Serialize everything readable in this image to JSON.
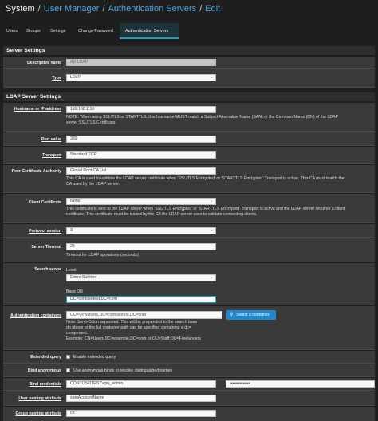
{
  "breadcrumb": {
    "system": "System",
    "sep": "/",
    "user_manager": "User Manager",
    "auth_servers": "Authentication Servers",
    "edit": "Edit"
  },
  "tabs": [
    {
      "label": "Users"
    },
    {
      "label": "Groups"
    },
    {
      "label": "Settings"
    },
    {
      "label": "Change Password"
    },
    {
      "label": "Authentication Servers"
    }
  ],
  "server_settings": {
    "heading": "Server Settings",
    "descriptive_name": {
      "label": "Descriptive name",
      "value": "AD LDAP"
    },
    "type": {
      "label": "Type",
      "value": "LDAP"
    }
  },
  "ldap": {
    "heading": "LDAP Server Settings",
    "hostname": {
      "label": "Hostname or IP address",
      "value": "192.168.2.10",
      "help": "NOTE: When using SSL/TLS or STARTTLS, this hostname MUST match a Subject Alternative Name (SAN) or the Common Name (CN) of the LDAP\nserver SSL/TLS Certificate."
    },
    "port": {
      "label": "Port value",
      "value": "389"
    },
    "transport": {
      "label": "Transport",
      "value": "Standard TCP"
    },
    "peer_ca": {
      "label": "Peer Certificate Authority",
      "value": "Global Root CA List",
      "help": "This CA is used to validate the LDAP server certificate when 'SSL/TLS Encrypted' or 'STARTTLS Encrypted' Transport is active. This CA must match the\nCA used by the LDAP server."
    },
    "client_cert": {
      "label": "Client Certificate",
      "value": "None",
      "help": "This certificate is sent to the LDAP server when 'SSL/TLS Encrypted' or 'STARTTLS Encrypted' Transport is active and the LDAP server requires a client\ncertificate. This certificate must be issued by the CA the LDAP server uses to validate connecting clients."
    },
    "protocol": {
      "label": "Protocol version",
      "value": "3"
    },
    "timeout": {
      "label": "Server Timeout",
      "value": "25",
      "help": "Timeout for LDAP operations (seconds)"
    },
    "scope": {
      "label": "Search scope",
      "level_label": "Level",
      "level_value": "Entire Subtree",
      "base_dn_label": "Base DN",
      "base_dn_value": "DC=contosotest,DC=com"
    },
    "containers": {
      "label": "Authentication containers",
      "value": "OU=VPNUsers,DC=contosotest,DC=com",
      "button": "Select a container",
      "help": "Note: Semi-Colon separated. This will be prepended to the search base\ndn above or the full container path can be specified containing a dc=\ncomponent.\nExample: CN=Users;DC=example,DC=com or OU=Staff;OU=Freelancers"
    },
    "extended_query": {
      "label": "Extended query",
      "text": "Enable extended query"
    },
    "bind_anonymous": {
      "label": "Bind anonymous",
      "text": "Use anonymous binds to resolve distinguished names"
    },
    "bind_credentials": {
      "label": "Bind credentials",
      "user": "CONTOSOTEST\\vpn_admin",
      "password": "••••••••••••••"
    },
    "user_naming": {
      "label": "User naming attribute",
      "value": "samAccountName"
    },
    "group_naming": {
      "label": "Group naming attribute",
      "value": "cn"
    }
  },
  "icons": {
    "dropdown": "chevron-down-icon",
    "select_container": "search-icon"
  },
  "colors": {
    "accent": "#1f9dc4",
    "link": "#4ea6e0",
    "button": "#1f87cc"
  }
}
